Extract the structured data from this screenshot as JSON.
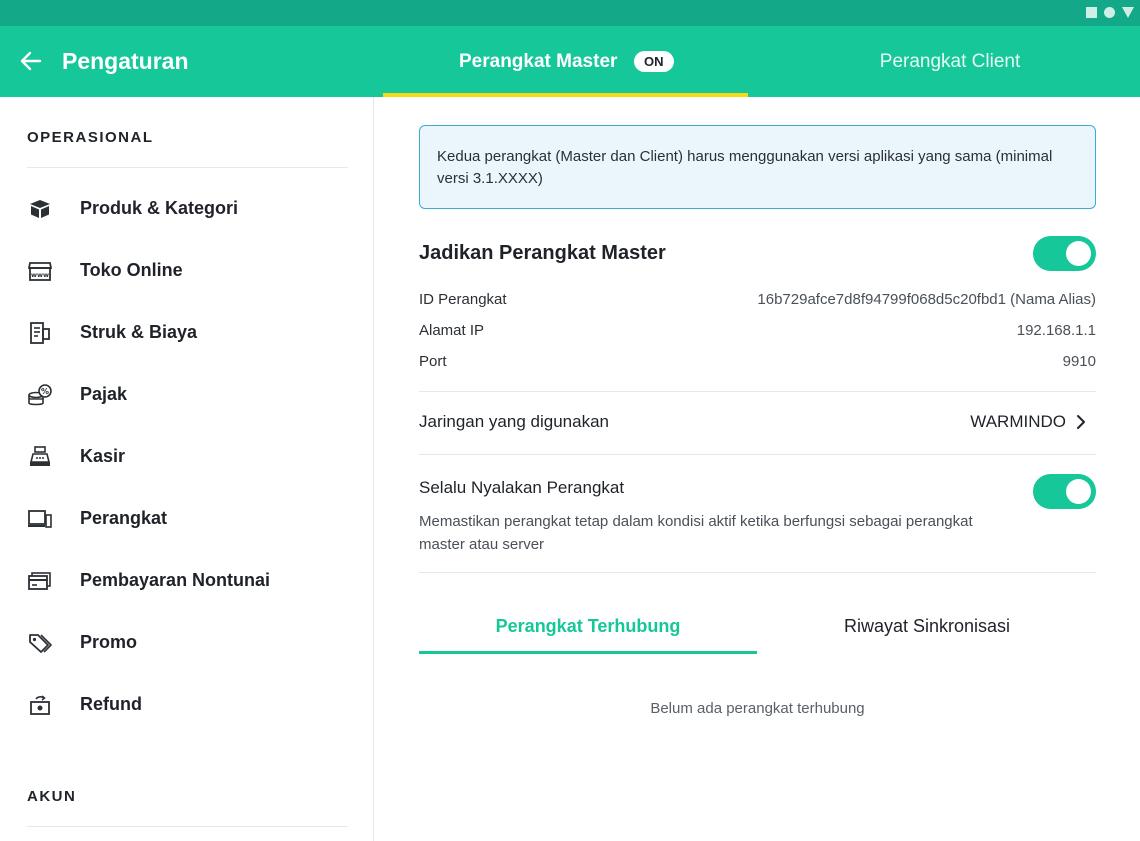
{
  "header": {
    "title": "Pengaturan",
    "tab_master": "Perangkat Master",
    "tab_master_badge": "ON",
    "tab_client": "Perangkat Client"
  },
  "sidebar": {
    "section_operasional": "OPERASIONAL",
    "items": [
      {
        "label": "Produk & Kategori",
        "icon": "box-icon"
      },
      {
        "label": "Toko Online",
        "icon": "store-www-icon"
      },
      {
        "label": "Struk & Biaya",
        "icon": "receipt-icon"
      },
      {
        "label": "Pajak",
        "icon": "tax-coins-icon"
      },
      {
        "label": "Kasir",
        "icon": "cashier-icon"
      },
      {
        "label": "Perangkat",
        "icon": "devices-icon"
      },
      {
        "label": "Pembayaran Nontunai",
        "icon": "card-icon"
      },
      {
        "label": "Promo",
        "icon": "tag-icon"
      },
      {
        "label": "Refund",
        "icon": "refund-icon"
      }
    ],
    "section_akun": "AKUN"
  },
  "main": {
    "info_text": "Kedua perangkat (Master dan Client) harus menggunakan versi aplikasi yang sama (minimal versi 3.1.XXXX)",
    "master_title": "Jadikan Perangkat Master",
    "master_toggle_on": true,
    "device_id_label": "ID Perangkat",
    "device_id_value": "16b729afce7d8f94799f068d5c20fbd1 (Nama Alias)",
    "ip_label": "Alamat IP",
    "ip_value": "192.168.1.1",
    "port_label": "Port",
    "port_value": "9910",
    "network_label": "Jaringan yang digunakan",
    "network_value": "WARMINDO",
    "always_on_title": "Selalu Nyalakan Perangkat",
    "always_on_desc": "Memastikan perangkat tetap dalam kondisi aktif ketika berfungsi sebagai perangkat master atau server",
    "always_on_toggle_on": true,
    "subtab_connected": "Perangkat Terhubung",
    "subtab_history": "Riwayat Sinkronisasi",
    "empty_state": "Belum ada perangkat terhubung"
  },
  "colors": {
    "primary": "#16c79a",
    "statusbar": "#12a888",
    "tab_indicator": "#f3dc16",
    "info_border": "#3aaad6",
    "info_bg": "#eaf6fc"
  }
}
